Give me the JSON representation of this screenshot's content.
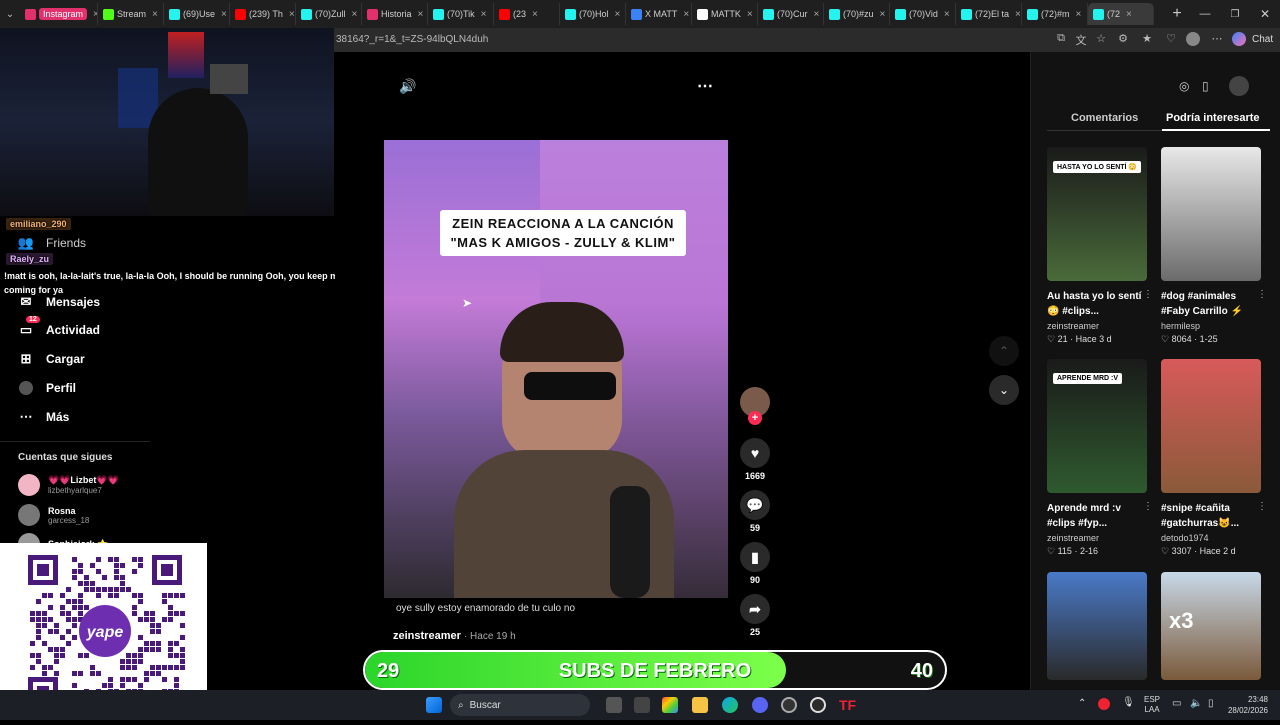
{
  "browser": {
    "tabs": [
      {
        "label": "Instagram",
        "color": "#e1306c"
      },
      {
        "label": "Stream",
        "color": "#53fc18"
      },
      {
        "label": "(69)Use",
        "color": "#25f4ee"
      },
      {
        "label": "(239) Th",
        "color": "#ff0000"
      },
      {
        "label": "(70)Zull",
        "color": "#25f4ee"
      },
      {
        "label": "Historia",
        "color": "#e1306c"
      },
      {
        "label": "(70)Tik",
        "color": "#25f4ee"
      },
      {
        "label": "(23",
        "color": "#ff0000"
      },
      {
        "label": "(70)Hol",
        "color": "#25f4ee"
      },
      {
        "label": "X MATT",
        "color": "#3b82f6"
      },
      {
        "label": "MATTK",
        "color": "#ffffff"
      },
      {
        "label": "(70)Cur",
        "color": "#25f4ee"
      },
      {
        "label": "(70)#zu",
        "color": "#25f4ee"
      },
      {
        "label": "(70)Vid",
        "color": "#25f4ee"
      },
      {
        "label": "(72)El ta",
        "color": "#25f4ee"
      },
      {
        "label": "(72)#m",
        "color": "#25f4ee"
      },
      {
        "label": "(72",
        "color": "#25f4ee"
      }
    ],
    "url": "38164?_r=1&_t=ZS-94lbQLN4duh",
    "chat_label": "Chat"
  },
  "left_nav": {
    "items": [
      {
        "label": "Friends",
        "icon": "friends-icon"
      },
      {
        "label": "Mensajes",
        "icon": "messages-icon"
      },
      {
        "label": "Actividad",
        "icon": "activity-icon",
        "badge": "12"
      },
      {
        "label": "Cargar",
        "icon": "upload-icon"
      },
      {
        "label": "Perfil",
        "icon": "profile-icon"
      },
      {
        "label": "Más",
        "icon": "more-icon"
      }
    ],
    "following_title": "Cuentas que sigues",
    "following": [
      {
        "name": "💗💗Lizbet💗💗",
        "handle": "lizbethyarlque7"
      },
      {
        "name": "Rosna",
        "handle": "garcess_18"
      },
      {
        "name": "Sophiejork ⭐",
        "handle": ""
      }
    ]
  },
  "stream_overlay": {
    "chat": [
      {
        "user": "emiliano_290",
        "text": ""
      },
      {
        "user": "Raely_zu",
        "text": "!matt is ooh, la-la-lait's true, la-la-la Ooh, I should be running Ooh, you keep me coming for ya"
      }
    ],
    "qr_brand": "yape",
    "subs": {
      "current": "29",
      "goal": "40",
      "label": "SUBS DE FEBRERO",
      "progress": 0.725
    }
  },
  "video": {
    "caption_line1": "ZEIN REACCIONA A LA CANCIÓN",
    "caption_line2": "\"MAS K AMIGOS - ZULLY & KLIM\"",
    "subtitle": "oye sully estoy enamorado de tu culo no",
    "author": "zeinstreamer",
    "time": "· Hace 19 h",
    "likes": "1669",
    "comments": "59",
    "saves": "90",
    "shares": "25"
  },
  "right_panel": {
    "tabs": [
      "Comentarios",
      "Podría interesarte"
    ],
    "cards": [
      {
        "title": "Au hasta yo lo sentí 😳 #clips...",
        "author": "zeinstreamer",
        "likes": "21",
        "time": "Hace 3 d",
        "overlay": "HASTA YO LO SENTÍ 😳",
        "c1": "#1a1a1a",
        "c2": "#4a6b3a"
      },
      {
        "title": "#dog #animales #Faby Carrillo ⚡",
        "author": "hermilesp",
        "likes": "8064",
        "time": "1-25",
        "overlay": "",
        "c1": "#e8e8e8",
        "c2": "#6b6b6b"
      },
      {
        "title": "Aprende mrd :v #clips #fyp...",
        "author": "zeinstreamer",
        "likes": "115",
        "time": "2-16",
        "overlay": "APRENDE MRD :V",
        "c1": "#1a1a1a",
        "c2": "#2f5a2f"
      },
      {
        "title": "#snipe #cañita #gatchurras😺...",
        "author": "detodo1974",
        "likes": "3307",
        "time": "Hace 2 d",
        "overlay": "",
        "c1": "#d85a5a",
        "c2": "#8a5a3a"
      },
      {
        "title": "",
        "author": "",
        "likes": "",
        "time": "",
        "overlay": "",
        "c1": "#4a7ac8",
        "c2": "#2a2a2a"
      },
      {
        "title": "",
        "author": "",
        "likes": "",
        "time": "",
        "overlay": "x3",
        "c1": "#c8d8e8",
        "c2": "#7a5a3a"
      }
    ]
  },
  "taskbar": {
    "search": "Buscar",
    "lang1": "ESP",
    "lang2": "LAA",
    "time": "23:48",
    "date": "28/02/2026"
  }
}
